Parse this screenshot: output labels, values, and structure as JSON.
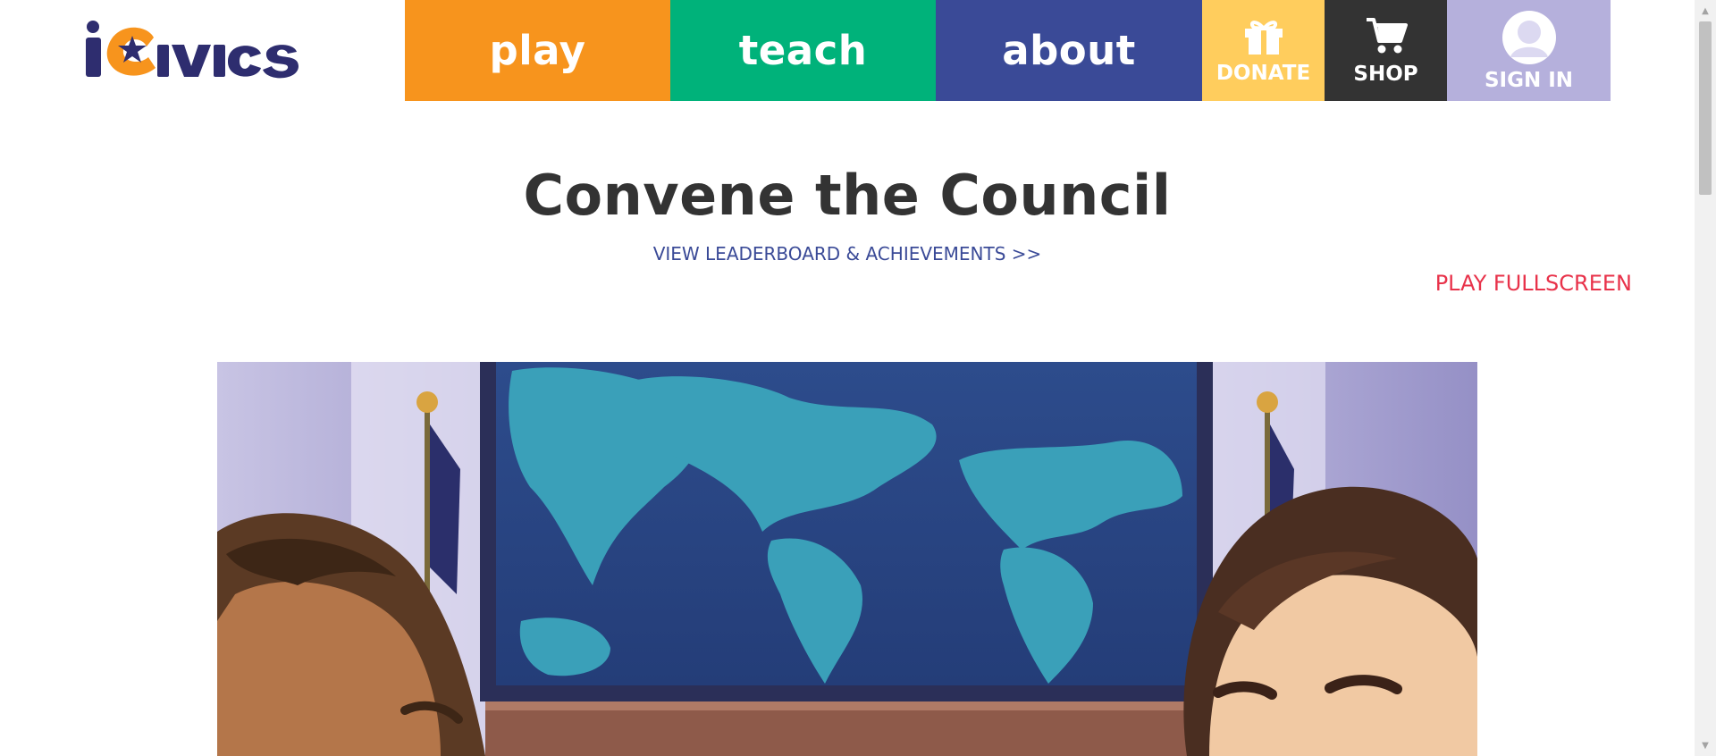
{
  "header": {
    "logo_text": "iCivics",
    "nav": {
      "play": "play",
      "teach": "teach",
      "about": "about",
      "donate": "DONATE",
      "shop": "SHOP",
      "sign_in": "SIGN IN"
    },
    "icons": {
      "donate": "gift-icon",
      "shop": "cart-icon",
      "sign_in": "user-avatar-icon"
    }
  },
  "game": {
    "title": "Convene the Council",
    "leaderboard_link": "VIEW LEADERBOARD & ACHIEVEMENTS >>",
    "fullscreen_link": "PLAY FULLSCREEN"
  },
  "colors": {
    "play": "#f7941d",
    "teach": "#00b27a",
    "about": "#3a4a97",
    "donate": "#ffcd5d",
    "shop": "#333333",
    "sign_in": "#b5b0dc",
    "fullscreen_link": "#e8324a",
    "leaderboard_link": "#3a4a97"
  }
}
